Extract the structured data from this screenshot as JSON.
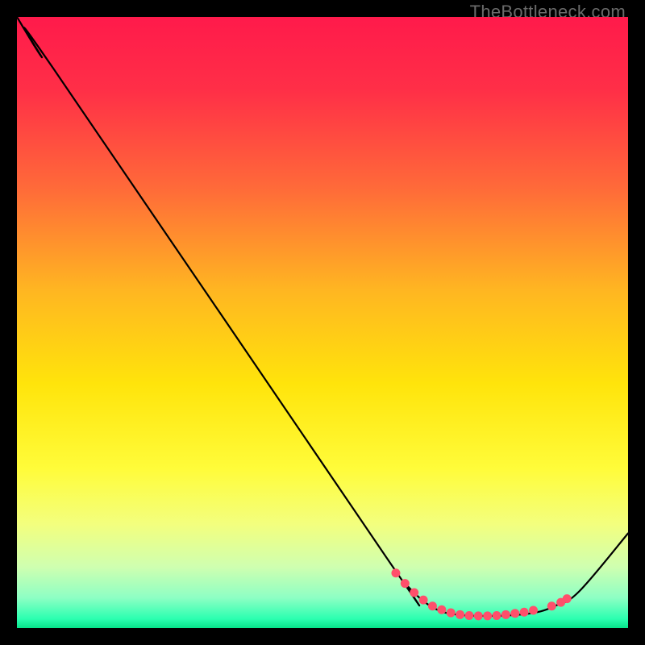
{
  "watermark": "TheBottleneck.com",
  "chart_data": {
    "type": "line",
    "title": "",
    "xlabel": "",
    "ylabel": "",
    "xlim": [
      0,
      100
    ],
    "ylim": [
      0,
      100
    ],
    "gradient_stops": [
      {
        "offset": 0.0,
        "color": "#ff1a4b"
      },
      {
        "offset": 0.12,
        "color": "#ff2f47"
      },
      {
        "offset": 0.28,
        "color": "#ff6a39"
      },
      {
        "offset": 0.45,
        "color": "#ffb721"
      },
      {
        "offset": 0.6,
        "color": "#ffe40b"
      },
      {
        "offset": 0.74,
        "color": "#fffc3a"
      },
      {
        "offset": 0.83,
        "color": "#f3ff7e"
      },
      {
        "offset": 0.9,
        "color": "#cfffb0"
      },
      {
        "offset": 0.95,
        "color": "#8effc4"
      },
      {
        "offset": 0.985,
        "color": "#2bffb0"
      },
      {
        "offset": 1.0,
        "color": "#06e38a"
      }
    ],
    "series": [
      {
        "name": "curve",
        "points": [
          {
            "x": 0.0,
            "y": 100.0
          },
          {
            "x": 4.0,
            "y": 93.5
          },
          {
            "x": 6.0,
            "y": 91.5
          },
          {
            "x": 60.5,
            "y": 11.5
          },
          {
            "x": 64.0,
            "y": 6.8
          },
          {
            "x": 68.0,
            "y": 3.4
          },
          {
            "x": 72.0,
            "y": 2.2
          },
          {
            "x": 78.0,
            "y": 2.0
          },
          {
            "x": 84.0,
            "y": 2.4
          },
          {
            "x": 88.0,
            "y": 3.6
          },
          {
            "x": 92.0,
            "y": 6.0
          },
          {
            "x": 100.0,
            "y": 15.5
          }
        ]
      }
    ],
    "markers": [
      {
        "x": 62.0,
        "y": 9.0
      },
      {
        "x": 63.5,
        "y": 7.3
      },
      {
        "x": 65.0,
        "y": 5.8
      },
      {
        "x": 66.5,
        "y": 4.6
      },
      {
        "x": 68.0,
        "y": 3.6
      },
      {
        "x": 69.5,
        "y": 3.0
      },
      {
        "x": 71.0,
        "y": 2.5
      },
      {
        "x": 72.5,
        "y": 2.2
      },
      {
        "x": 74.0,
        "y": 2.05
      },
      {
        "x": 75.5,
        "y": 2.0
      },
      {
        "x": 77.0,
        "y": 2.0
      },
      {
        "x": 78.5,
        "y": 2.05
      },
      {
        "x": 80.0,
        "y": 2.2
      },
      {
        "x": 81.5,
        "y": 2.4
      },
      {
        "x": 83.0,
        "y": 2.6
      },
      {
        "x": 84.5,
        "y": 2.9
      },
      {
        "x": 87.5,
        "y": 3.6
      },
      {
        "x": 89.0,
        "y": 4.2
      },
      {
        "x": 90.0,
        "y": 4.8
      }
    ],
    "marker_color": "#ff4f6b",
    "marker_radius": 5.5,
    "line_color": "#000000",
    "line_width": 2.2
  }
}
